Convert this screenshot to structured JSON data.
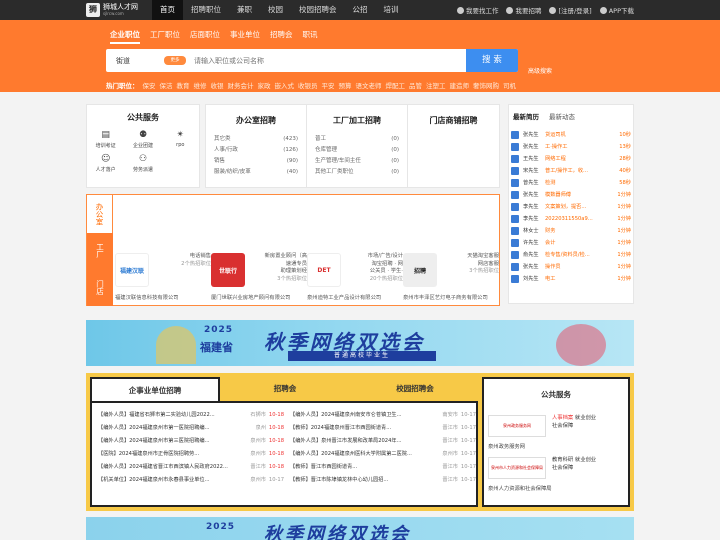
{
  "site": {
    "logo_main": "狮城人才网",
    "logo_sub": "sjlrcw.com",
    "logo_mark": "狮"
  },
  "topnav": [
    "首页",
    "招聘职位",
    "兼职",
    "校园",
    "校园招聘会",
    "公招",
    "培训"
  ],
  "topright": {
    "find_job": "我要找工作",
    "hire": "我要招聘",
    "login": "[注册/登录]",
    "app": "APP下载"
  },
  "search": {
    "tabs": [
      "企业职位",
      "工厂职位",
      "店面职位",
      "事业单位",
      "招聘会",
      "职讯"
    ],
    "city": "街道",
    "badge": "更多",
    "placeholder": "请输入职位或公司名称",
    "button": "搜 索",
    "advanced": "高级搜索"
  },
  "hot": {
    "label": "热门职位：",
    "items": [
      "保安",
      "保洁",
      "教育",
      "维修",
      "收银",
      "财务会计",
      "家政",
      "嵌入式",
      "收银员",
      "平安",
      "预算",
      "语文老师",
      "焊配工",
      "品管",
      "注塑工",
      "建造师",
      "奢饰网购",
      "司机"
    ]
  },
  "public_service": {
    "title": "公共服务",
    "items": [
      {
        "label": "培训考证",
        "icon": "book-icon"
      },
      {
        "label": "企业团建",
        "icon": "group-icon"
      },
      {
        "label": "rpo",
        "icon": "network-icon"
      },
      {
        "label": "人才落户",
        "icon": "person-icon"
      },
      {
        "label": "劳务派遣",
        "icon": "team-icon"
      }
    ]
  },
  "categories": [
    {
      "title": "办公室招聘",
      "rows": [
        {
          "name": "其它类",
          "count": "(423)"
        },
        {
          "name": "人事/行政",
          "count": "(126)"
        },
        {
          "name": "销售",
          "count": "(90)"
        },
        {
          "name": "服装/纺织/皮革",
          "count": "(40)"
        }
      ]
    },
    {
      "title": "工厂加工招聘",
      "rows": [
        {
          "name": "普工",
          "count": "(0)"
        },
        {
          "name": "仓库管理",
          "count": "(0)"
        },
        {
          "name": "生产管理/车间主任",
          "count": "(0)"
        },
        {
          "name": "其他工厂类职位",
          "count": "(0)"
        }
      ]
    },
    {
      "title": "门店商铺招聘",
      "rows": []
    }
  ],
  "news": {
    "tabs": [
      "最新简历",
      "最新动态"
    ],
    "rows": [
      {
        "name": "张先生",
        "job": "货运司机",
        "time": "10秒"
      },
      {
        "name": "张先生",
        "job": "工·操作工",
        "time": "13秒"
      },
      {
        "name": "王先生",
        "job": "网络工程",
        "time": "28秒"
      },
      {
        "name": "宋先生",
        "job": "普工/操作工，收...",
        "time": "40秒"
      },
      {
        "name": "曾先生",
        "job": "检测",
        "time": "58秒"
      },
      {
        "name": "张先生",
        "job": "模数器师傅",
        "time": "1分钟"
      },
      {
        "name": "李先生",
        "job": "文案策划，提否...",
        "time": "1分钟"
      },
      {
        "name": "李先生",
        "job": "20220311550a9...",
        "time": "1分钟"
      },
      {
        "name": "林女士",
        "job": "财务",
        "time": "1分钟"
      },
      {
        "name": "许先生",
        "job": "会计",
        "time": "1分钟"
      },
      {
        "name": "俞先生",
        "job": "检专售/资料员/检...",
        "time": "1分钟"
      },
      {
        "name": "张先生",
        "job": "操作员",
        "time": "1分钟"
      },
      {
        "name": "刘先生",
        "job": "电工",
        "time": "1分钟"
      }
    ]
  },
  "company_tabs": [
    "办公室",
    "工厂",
    "门店"
  ],
  "companies": [
    {
      "logo": "福建汉联",
      "meta": [
        "电话销售",
        "2个热招职位"
      ],
      "name": "福建汉联信息科技有限公司",
      "bg": "#ffffff",
      "fg": "#2d7bd3"
    },
    {
      "logo": "世联行",
      "meta": [
        "新房置业顾问（高",
        "速通专员",
        "助理策划经",
        "3个热招职位"
      ],
      "name": "厦门世联兴业房地产顾问有限公司",
      "bg": "#d93030",
      "fg": "#ffffff"
    },
    {
      "logo": "DET",
      "meta": [
        "市场/广告/设计",
        "淘宝招聘 · 网",
        "公关员 · 学生·",
        "20个热招职位"
      ],
      "name": "泉州迪特工业产品设计有限公司",
      "bg": "#ffffff",
      "fg": "#d93030"
    },
    {
      "logo": "招聘",
      "meta": [
        "天猫淘宝客服",
        "网店客服",
        "3个热招职位"
      ],
      "name": "泉州市丰泽区艺灯电子商务有限公司",
      "bg": "#eeeeee",
      "fg": "#222222"
    }
  ],
  "banner": {
    "year": "2025",
    "province": "福建省",
    "main": "秋季网络双选会",
    "sub": "普通高校毕业生"
  },
  "jobs": {
    "tabs": [
      "企事业单位招聘",
      "招聘会",
      "校园招聘会"
    ],
    "left": [
      {
        "title": "【编外人员】福建省石狮市第二实验幼儿园2022...",
        "place": "石狮市",
        "date": "10-18",
        "hot": true
      },
      {
        "title": "【编外人员】2024福建泉州市第一医院招聘编...",
        "place": "泉州",
        "date": "10-18",
        "hot": true
      },
      {
        "title": "【编外人员】2024福建泉州市第三医院招聘编...",
        "place": "泉州市",
        "date": "10-18",
        "hot": true
      },
      {
        "title": "【医院】2024福建泉州市正骨医院招聘劳...",
        "place": "泉州市",
        "date": "10-18",
        "hot": true
      },
      {
        "title": "【编外人员】2024福建省晋江市西滨镇人民政府2022...",
        "place": "晋江市",
        "date": "10-18",
        "hot": true
      },
      {
        "title": "【机关单位】2024福建泉州市永春县事业单位...",
        "place": "泉州市",
        "date": "10-17",
        "hot": false
      }
    ],
    "right": [
      {
        "title": "【编外人员】2024福建泉州南安市仑苍镇卫生...",
        "place": "南安市",
        "date": "10-17"
      },
      {
        "title": "【教师】2024福建泉州晋江市西园街道青...",
        "place": "晋江市",
        "date": "10-17"
      },
      {
        "title": "【编外人员】泉州晋江市发展和改革局2024年...",
        "place": "晋江市",
        "date": "10-17"
      },
      {
        "title": "【编外人员】2024福建泉州医科大学附属第二医院...",
        "place": "泉州市",
        "date": "10-17"
      },
      {
        "title": "【教师】晋江市西园街道青...",
        "place": "晋江市",
        "date": "10-17"
      },
      {
        "title": "【教师】晋江市陈埭镇龙林中心幼儿园招...",
        "place": "晋江市",
        "date": "10-17"
      }
    ]
  },
  "pubsvc": {
    "title": "公共服务",
    "items": [
      {
        "logo": "泉州政务服务网",
        "tags": [
          "人事档案",
          "就业创业",
          "社会保障"
        ],
        "label": "泉州政务服务网"
      },
      {
        "logo": "泉州市人力资源和社会保障局",
        "tags": [
          "教育科研",
          "就业创业",
          "社会保障"
        ],
        "label": "泉州人力资源和社会保障局"
      }
    ]
  },
  "banner2": {
    "year": "2025",
    "main": "秋季网络双选会"
  }
}
